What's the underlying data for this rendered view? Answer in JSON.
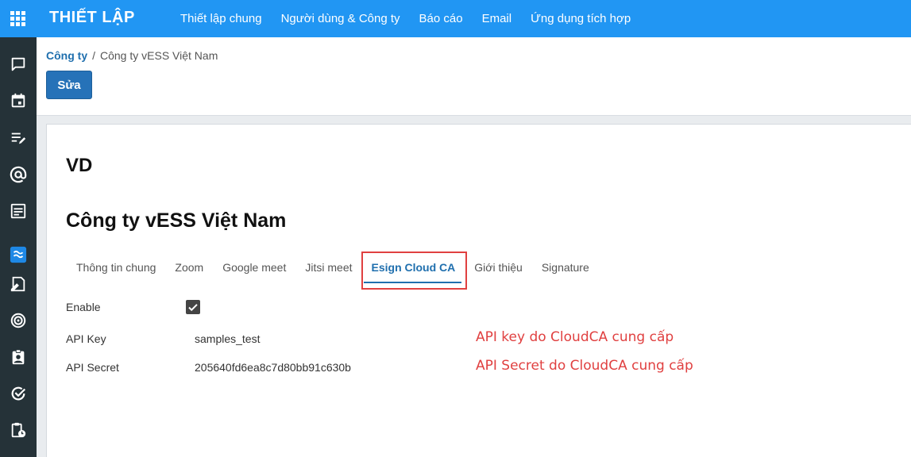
{
  "app": {
    "title": "THIẾT LẬP",
    "nav": [
      "Thiết lập chung",
      "Người dùng & Công ty",
      "Báo cáo",
      "Email",
      "Ứng dụng tích hợp"
    ]
  },
  "sidebar": {
    "icons": [
      "chat-icon",
      "calendar-icon",
      "notes-icon",
      "at-sign-icon",
      "document-icon",
      "sign-app-icon",
      "contract-sign-icon",
      "target-icon",
      "employee-badge-icon",
      "check-circle-icon",
      "clipboard-clock-icon"
    ]
  },
  "breadcrumb": {
    "parent": "Công ty",
    "separator": "/",
    "current": "Công ty vESS Việt Nam"
  },
  "toolbar": {
    "edit_label": "Sửa"
  },
  "record": {
    "ref": "VD",
    "name": "Công ty vESS Việt Nam"
  },
  "tabs": [
    {
      "label": "Thông tin chung",
      "active": false
    },
    {
      "label": "Zoom",
      "active": false
    },
    {
      "label": "Google meet",
      "active": false
    },
    {
      "label": "Jitsi meet",
      "active": false
    },
    {
      "label": "Esign Cloud CA",
      "active": true
    },
    {
      "label": "Giới thiệu",
      "active": false
    },
    {
      "label": "Signature",
      "active": false
    }
  ],
  "fields": {
    "enable": {
      "label": "Enable",
      "checked": true
    },
    "api_key": {
      "label": "API Key",
      "value": "samples_test",
      "note": "API key do CloudCA cung cấp"
    },
    "api_secret": {
      "label": "API Secret",
      "value": "205640fd6ea8c7d80bb91c630b",
      "note": "API Secret do CloudCA cung cấp"
    }
  },
  "colors": {
    "topbar": "#2196f3",
    "sidebar": "#253238",
    "accent": "#1f6fae",
    "button": "#2672b8",
    "annotation": "#e04040"
  }
}
